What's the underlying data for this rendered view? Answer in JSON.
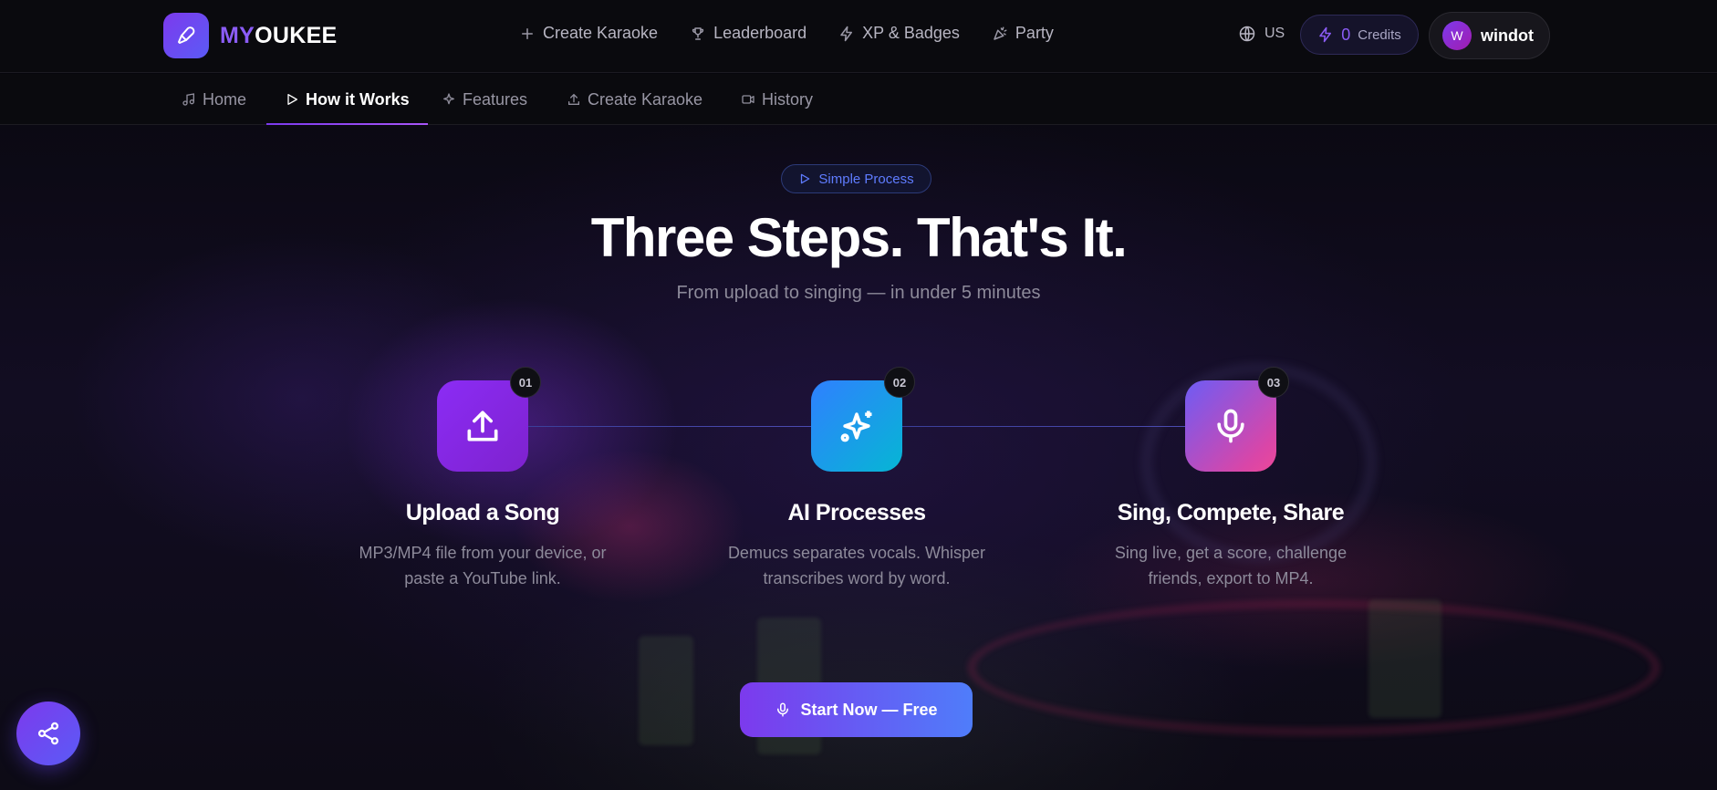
{
  "brand": {
    "name_part1": "MY",
    "name_part2": "OUKEE"
  },
  "top_nav": [
    {
      "label": "Create Karaoke",
      "icon": "plus-icon"
    },
    {
      "label": "Leaderboard",
      "icon": "trophy-icon"
    },
    {
      "label": "XP & Badges",
      "icon": "bolt-icon"
    },
    {
      "label": "Party",
      "icon": "party-popper-icon"
    }
  ],
  "language": {
    "label": "US",
    "icon": "globe-icon"
  },
  "credits": {
    "count": "0",
    "label": "Credits",
    "icon": "bolt-icon"
  },
  "user": {
    "initial": "W",
    "name": "windot"
  },
  "sub_nav": [
    {
      "label": "Home",
      "icon": "music-note-icon",
      "active": false
    },
    {
      "label": "How it Works",
      "icon": "play-icon",
      "active": true
    },
    {
      "label": "Features",
      "icon": "sparkles-icon",
      "active": false
    },
    {
      "label": "Create Karaoke",
      "icon": "upload-icon",
      "active": false
    },
    {
      "label": "History",
      "icon": "video-icon",
      "active": false
    }
  ],
  "hero": {
    "pill": "Simple Process",
    "title": "Three Steps. That's It.",
    "subtitle": "From upload to singing — in under 5 minutes"
  },
  "steps": [
    {
      "number": "01",
      "title": "Upload a Song",
      "description": "MP3/MP4 file from your device, or paste a YouTube link.",
      "icon": "upload-icon",
      "color": "#8b2cf5"
    },
    {
      "number": "02",
      "title": "AI Processes",
      "description": "Demucs separates vocals. Whisper transcribes word by word.",
      "icon": "sparkles-icon",
      "color": "#1597f0"
    },
    {
      "number": "03",
      "title": "Sing, Compete, Share",
      "description": "Sing live, get a score, challenge friends, export to MP4.",
      "icon": "microphone-icon",
      "color": "#d946a8"
    }
  ],
  "cta": {
    "label": "Start Now — Free",
    "icon": "microphone-icon"
  },
  "share": {
    "icon": "share-icon"
  }
}
